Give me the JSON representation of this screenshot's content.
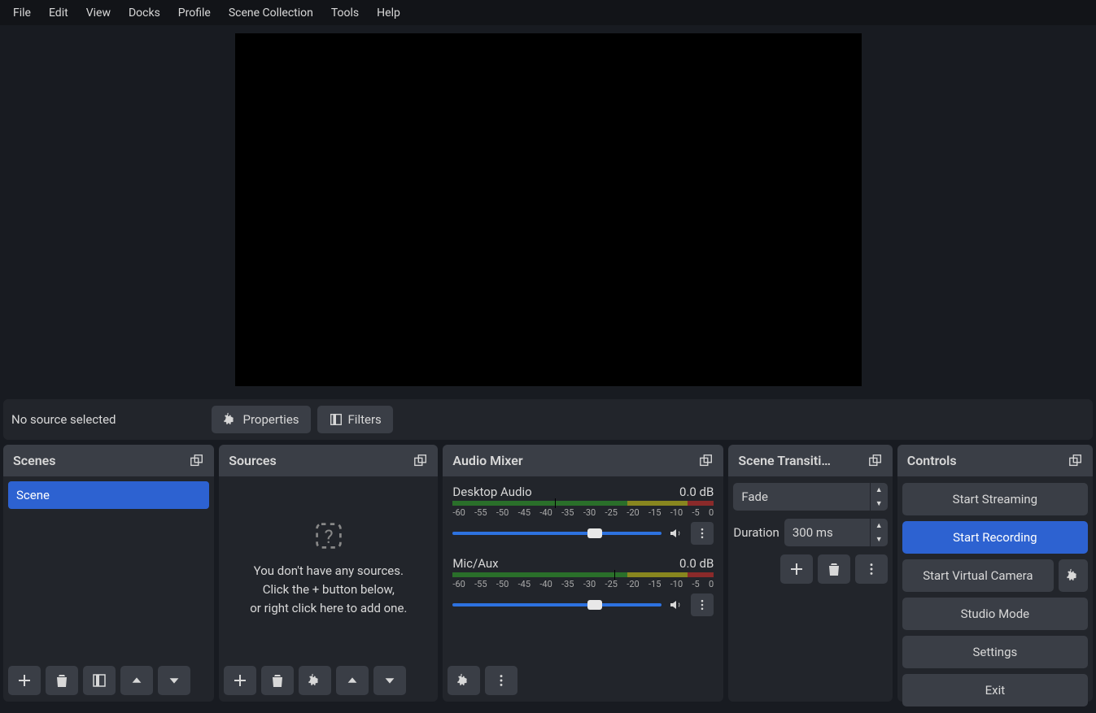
{
  "menu": [
    "File",
    "Edit",
    "View",
    "Docks",
    "Profile",
    "Scene Collection",
    "Tools",
    "Help"
  ],
  "toolbar": {
    "status": "No source selected",
    "properties": "Properties",
    "filters": "Filters"
  },
  "scenes": {
    "title": "Scenes",
    "items": [
      "Scene"
    ]
  },
  "sources": {
    "title": "Sources",
    "empty1": "You don't have any sources.",
    "empty2": "Click the + button below,",
    "empty3": "or right click here to add one."
  },
  "mixer": {
    "title": "Audio Mixer",
    "ticks": [
      "-60",
      "-55",
      "-50",
      "-45",
      "-40",
      "-35",
      "-30",
      "-25",
      "-20",
      "-15",
      "-10",
      "-5",
      "0"
    ],
    "channels": [
      {
        "name": "Desktop Audio",
        "level": "0.0 dB",
        "thumb": 68
      },
      {
        "name": "Mic/Aux",
        "level": "0.0 dB",
        "thumb": 68
      }
    ]
  },
  "transitions": {
    "title": "Scene Transiti…",
    "selected": "Fade",
    "duration_label": "Duration",
    "duration_value": "300 ms"
  },
  "controls": {
    "title": "Controls",
    "streaming": "Start Streaming",
    "recording": "Start Recording",
    "virtual": "Start Virtual Camera",
    "studio": "Studio Mode",
    "settings": "Settings",
    "exit": "Exit"
  }
}
